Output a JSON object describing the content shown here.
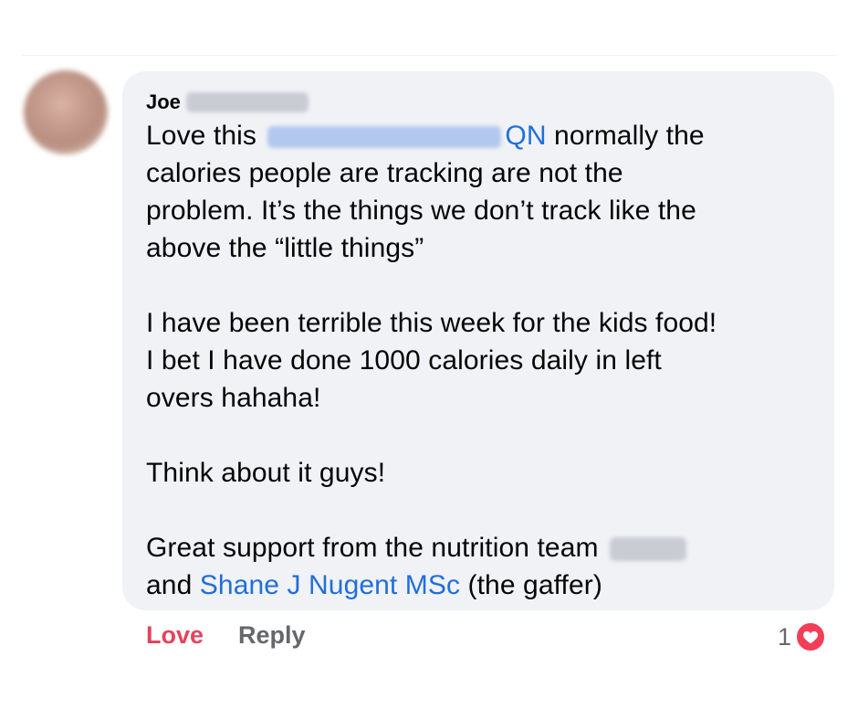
{
  "comment": {
    "author_first_name": "Joe",
    "text_start": "Love this",
    "mention_suffix": "QN",
    "line1_rest": " normally the",
    "line2": "calories people are tracking are not the",
    "line3": "problem. It’s the things we don’t track like the",
    "line4": "above the “little things”",
    "para2_line1": "I have been terrible this week for the kids food!",
    "para2_line2": "I bet I have done 1000 calories daily in left",
    "para2_line3": "overs hahaha!",
    "para3": "Think about it guys!",
    "para4_line1": "Great support from the nutrition team",
    "para4_line2_start": "and ",
    "mention_shane": "Shane J Nugent MSc",
    "para4_line2_end": " (the gaffer)"
  },
  "actions": {
    "love_label": "Love",
    "reply_label": "Reply"
  },
  "reactions": {
    "count": "1",
    "type_icon": "heart-icon"
  },
  "colors": {
    "bubble_bg": "#f0f2f5",
    "mention_blue": "#216fdb",
    "love_red": "#e4435c",
    "muted_gray": "#65676b"
  }
}
